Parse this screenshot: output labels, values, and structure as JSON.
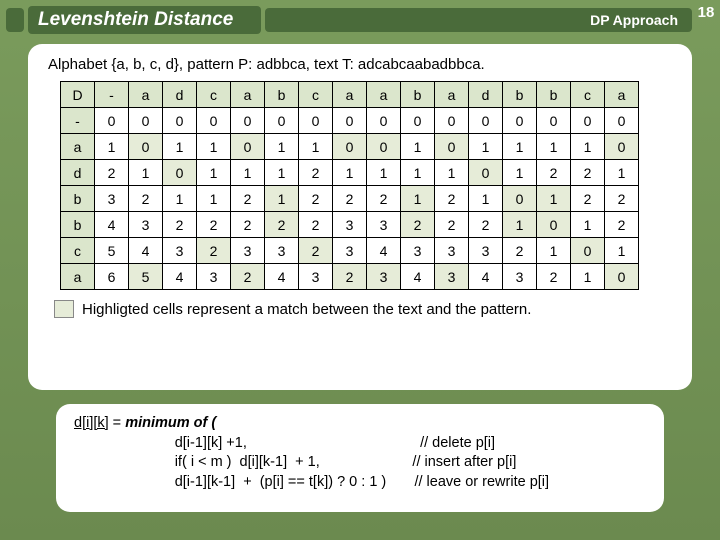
{
  "page_number": "18",
  "title": "Levenshtein Distance",
  "subtitle": "DP Approach",
  "description": "Alphabet {a, b, c, d},  pattern P: adbbca,  text T: adcabcaabadbbca.",
  "table": {
    "corner": "D",
    "col_headers": [
      "-",
      "a",
      "d",
      "c",
      "a",
      "b",
      "c",
      "a",
      "a",
      "b",
      "a",
      "d",
      "b",
      "b",
      "c",
      "a"
    ],
    "row_headers": [
      "-",
      "a",
      "d",
      "b",
      "b",
      "c",
      "a"
    ],
    "rows": [
      [
        0,
        0,
        0,
        0,
        0,
        0,
        0,
        0,
        0,
        0,
        0,
        0,
        0,
        0,
        0,
        0
      ],
      [
        1,
        0,
        1,
        1,
        0,
        1,
        1,
        0,
        0,
        1,
        0,
        1,
        1,
        1,
        1,
        0
      ],
      [
        2,
        1,
        0,
        1,
        1,
        1,
        2,
        1,
        1,
        1,
        1,
        0,
        1,
        2,
        2,
        1
      ],
      [
        3,
        2,
        1,
        1,
        2,
        1,
        2,
        2,
        2,
        1,
        2,
        1,
        0,
        1,
        2,
        2
      ],
      [
        4,
        3,
        2,
        2,
        2,
        2,
        2,
        3,
        3,
        2,
        2,
        2,
        1,
        0,
        1,
        2
      ],
      [
        5,
        4,
        3,
        2,
        3,
        3,
        2,
        3,
        4,
        3,
        3,
        3,
        2,
        1,
        0,
        1
      ],
      [
        6,
        5,
        4,
        3,
        2,
        4,
        3,
        2,
        3,
        4,
        3,
        4,
        3,
        2,
        1,
        0
      ]
    ],
    "match_cells": [
      [
        1,
        1
      ],
      [
        1,
        4
      ],
      [
        1,
        7
      ],
      [
        1,
        8
      ],
      [
        1,
        10
      ],
      [
        1,
        15
      ],
      [
        2,
        2
      ],
      [
        2,
        11
      ],
      [
        3,
        5
      ],
      [
        3,
        9
      ],
      [
        3,
        12
      ],
      [
        3,
        13
      ],
      [
        4,
        5
      ],
      [
        4,
        9
      ],
      [
        4,
        12
      ],
      [
        4,
        13
      ],
      [
        5,
        3
      ],
      [
        5,
        6
      ],
      [
        5,
        14
      ],
      [
        6,
        1
      ],
      [
        6,
        4
      ],
      [
        6,
        7
      ],
      [
        6,
        8
      ],
      [
        6,
        10
      ],
      [
        6,
        15
      ]
    ]
  },
  "legend_text": "Highligted cells represent a match between the text and the pattern.",
  "formula": {
    "lhs": "d[i][k]",
    "eq": " = ",
    "rhs_head": "minimum of (",
    "line1_left": "                         d[i-1][k] +1,",
    "line1_right": "// delete p[i]",
    "line2_left": "                         if( i < m )  d[i][k-1]  + 1,",
    "line2_right": "// insert after p[i]",
    "line3_left": "                         d[i-1][k-1]  +  (p[i] == t[k]) ? 0 : 1 )",
    "line3_right": "// leave or rewrite p[i]"
  }
}
